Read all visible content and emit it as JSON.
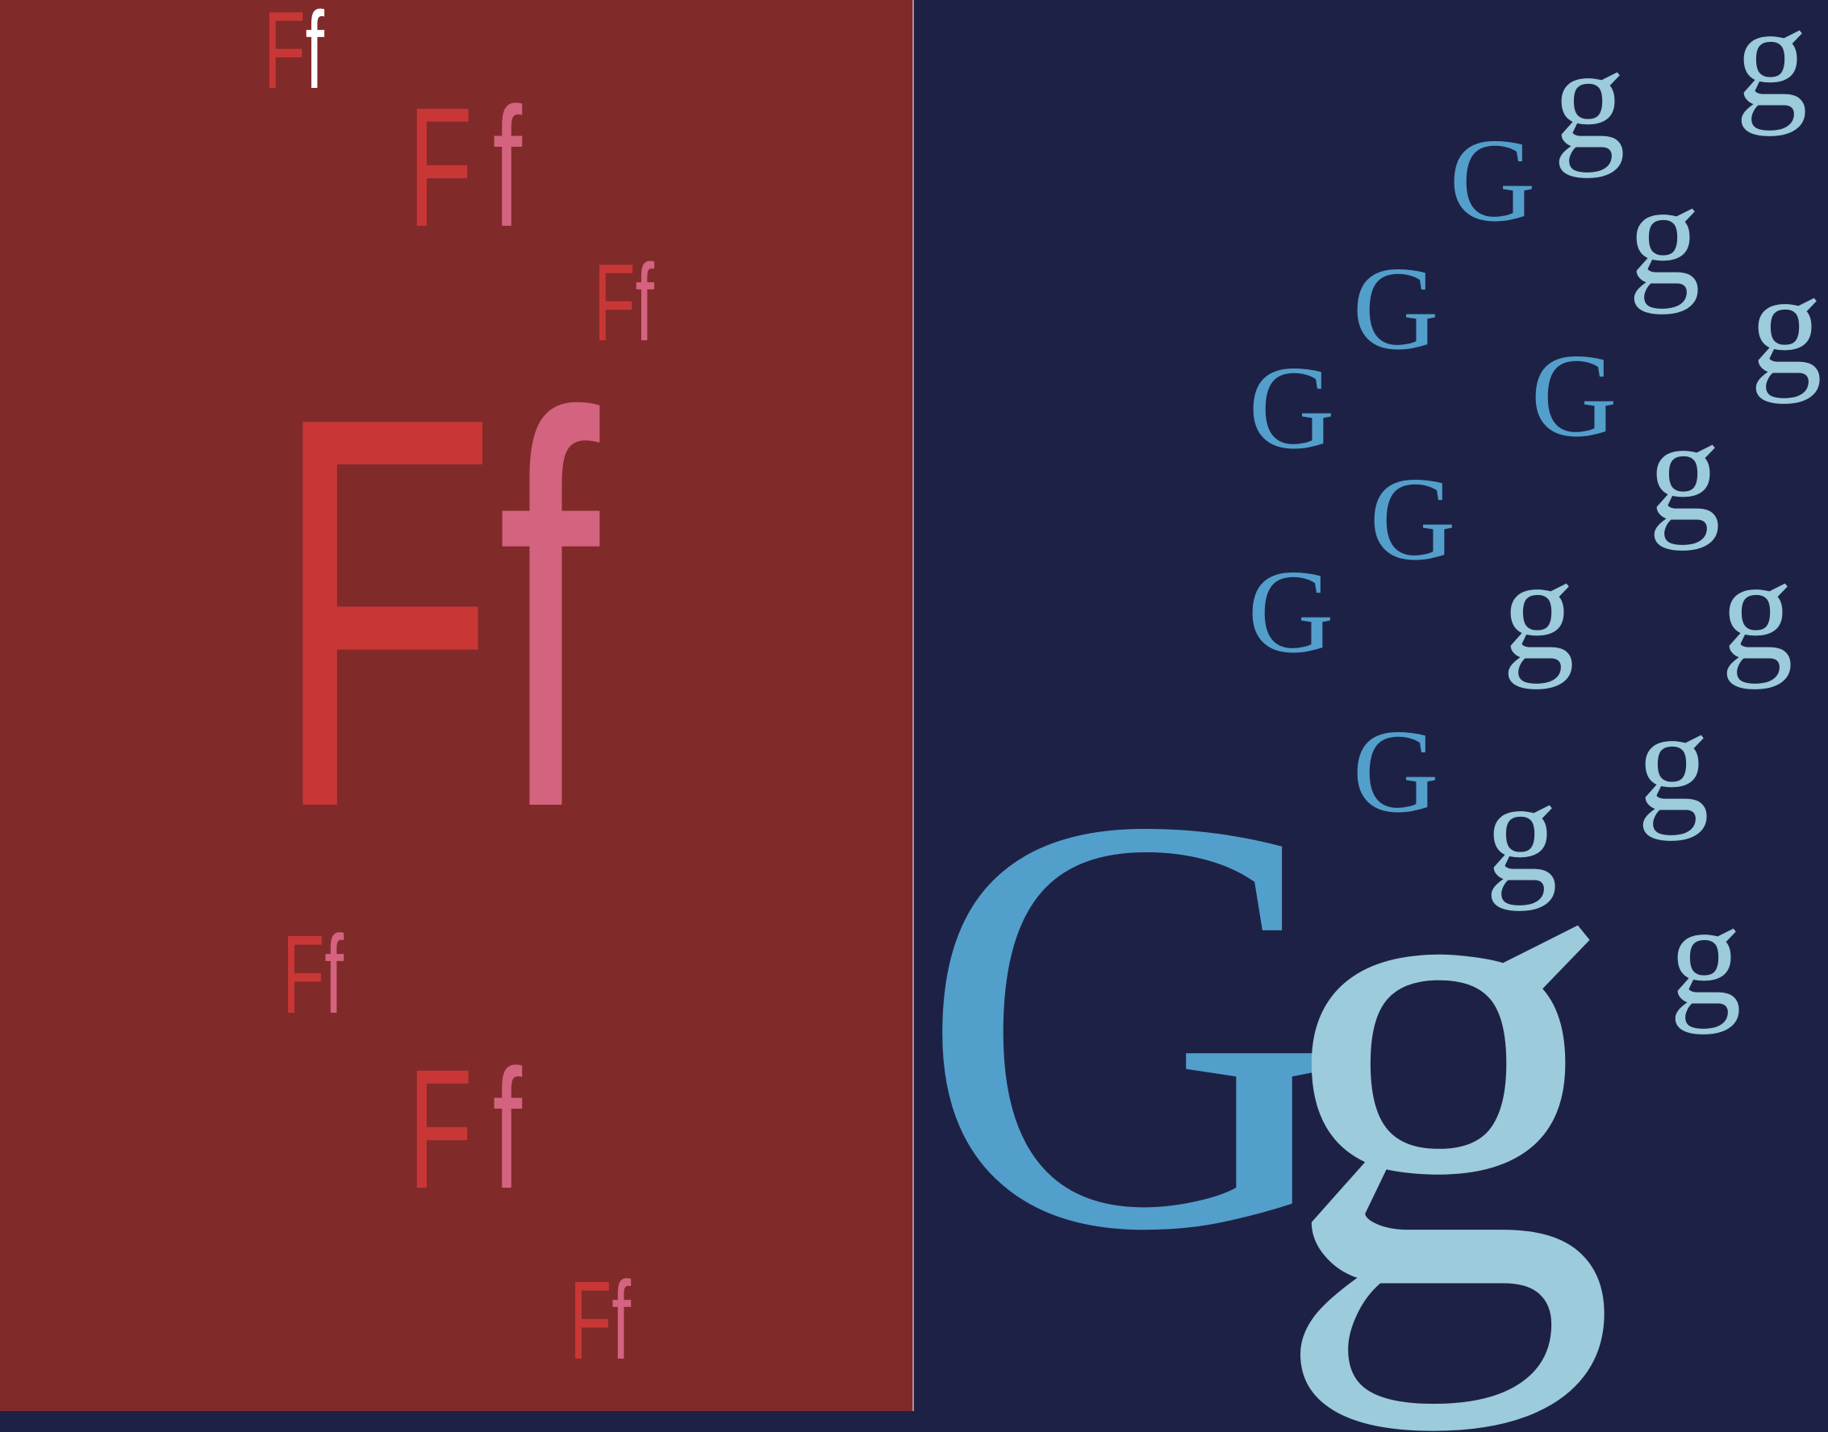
{
  "left_panel": {
    "background": "#812a2a",
    "upper": "F",
    "lower": "f",
    "colors": {
      "upper": "#c83735",
      "lower": "#d4637f",
      "accent_lower": "#ffffff"
    }
  },
  "right_panel": {
    "background": "#1e2146",
    "upper": "G",
    "lower": "g",
    "colors": {
      "upper": "#539fcb",
      "lower": "#9ccbdb"
    }
  }
}
